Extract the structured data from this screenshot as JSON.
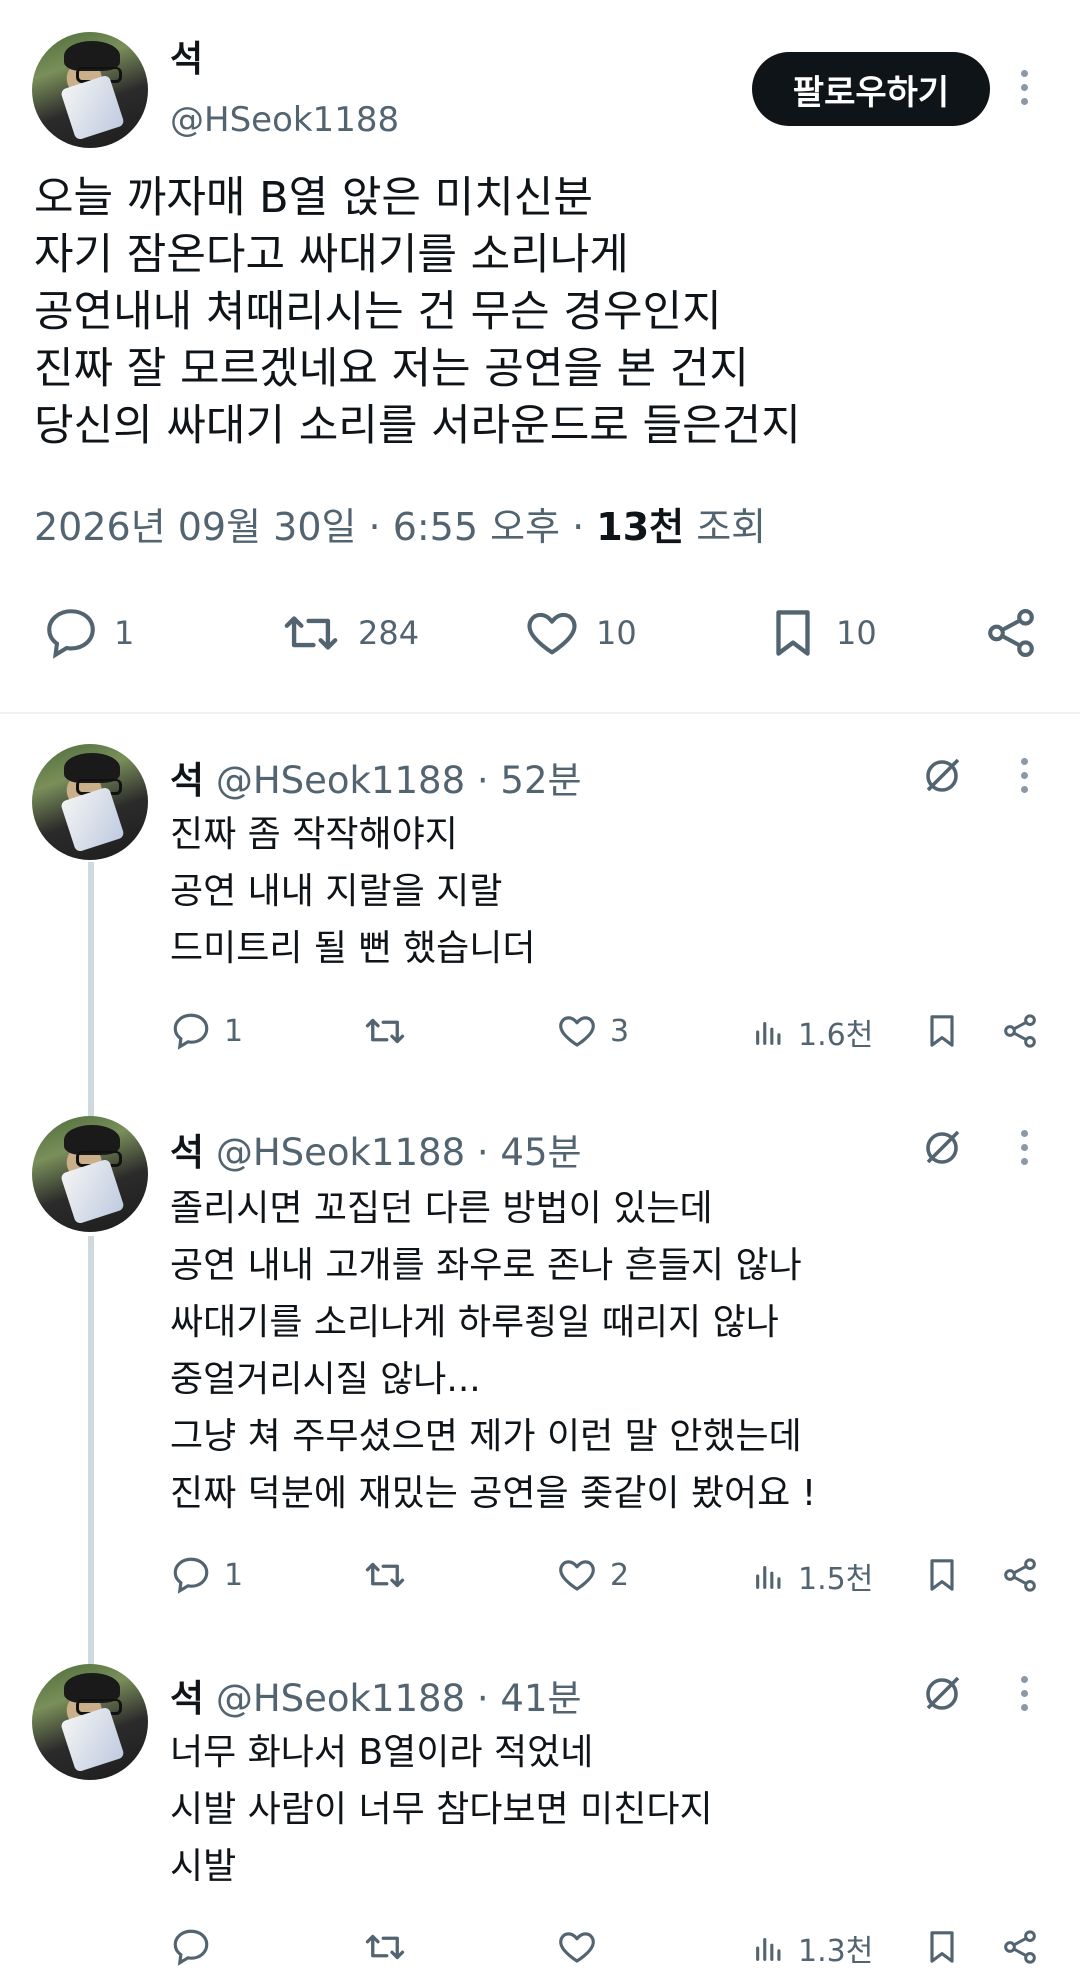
{
  "main": {
    "name": "석",
    "handle": "@HSeok1188",
    "follow_label": "팔로우하기",
    "lines": [
      "오늘 까자매 B열 앉은 미치신분",
      "자기 잠온다고 싸대기를 소리나게",
      "공연내내 쳐때리시는 건 무슨 경우인지",
      "진짜 잘 모르겠네요 저는 공연을 본 건지",
      "당신의 싸대기 소리를 서라운드로 들은건지"
    ],
    "timestamp": "2026년 09월 30일 · 6:55 오후 ·",
    "views_count": "13천",
    "views_label": "조회",
    "replies": "1",
    "reposts": "284",
    "likes": "10",
    "bookmarks": "10"
  },
  "replies": [
    {
      "name": "석",
      "handle": "@HSeok1188",
      "time": "· 52분",
      "lines": [
        "진짜 좀 작작해야지",
        "공연 내내 지랄을 지랄",
        "드미트리 될 뻔 했습니더"
      ],
      "replies": "1",
      "reposts": "",
      "likes": "3",
      "views": "1.6천"
    },
    {
      "name": "석",
      "handle": "@HSeok1188",
      "time": "· 45분",
      "lines": [
        "졸리시면 꼬집던 다른 방법이 있는데",
        "공연 내내 고개를 좌우로 존나 흔들지 않나",
        "싸대기를 소리나게 하루죙일 때리지 않나",
        "중얼거리시질 않나...",
        "그냥 쳐 주무셨으면 제가 이런 말 안했는데",
        "진짜 덕분에 재밌는 공연을 좆같이 봤어요 !"
      ],
      "replies": "1",
      "reposts": "",
      "likes": "2",
      "views": "1.5천"
    },
    {
      "name": "석",
      "handle": "@HSeok1188",
      "time": "· 41분",
      "lines": [
        "너무 화나서 B열이라 적었네",
        "시발 사람이 너무 참다보면 미친다지",
        "시발"
      ],
      "replies": "",
      "reposts": "",
      "likes": "",
      "views": "1.3천"
    }
  ]
}
